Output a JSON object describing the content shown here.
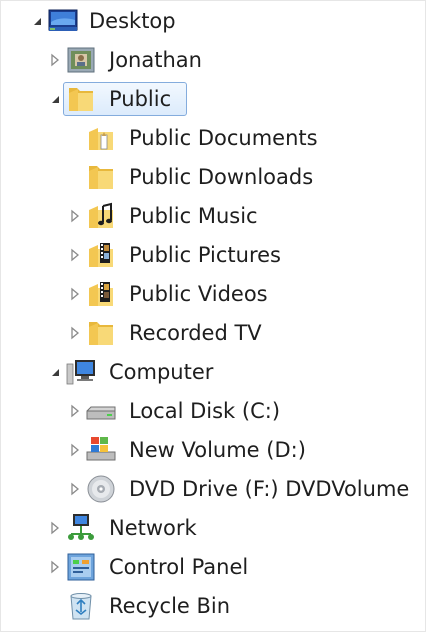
{
  "tree": {
    "items": [
      {
        "label": "Desktop",
        "icon": "desktop-icon",
        "state": "expanded"
      },
      {
        "label": "Jonathan",
        "icon": "user-folder-icon",
        "state": "collapsed"
      },
      {
        "label": "Public",
        "icon": "folder-icon",
        "state": "expanded",
        "selected": true
      },
      {
        "label": "Public Documents",
        "icon": "documents-folder-icon",
        "state": "none"
      },
      {
        "label": "Public Downloads",
        "icon": "folder-icon",
        "state": "none"
      },
      {
        "label": "Public Music",
        "icon": "music-folder-icon",
        "state": "collapsed"
      },
      {
        "label": "Public Pictures",
        "icon": "pictures-folder-icon",
        "state": "collapsed"
      },
      {
        "label": "Public Videos",
        "icon": "videos-folder-icon",
        "state": "collapsed"
      },
      {
        "label": "Recorded TV",
        "icon": "folder-icon",
        "state": "collapsed"
      },
      {
        "label": "Computer",
        "icon": "computer-icon",
        "state": "expanded"
      },
      {
        "label": "Local Disk (C:)",
        "icon": "hard-drive-icon",
        "state": "collapsed"
      },
      {
        "label": "New Volume (D:)",
        "icon": "windows-drive-icon",
        "state": "collapsed"
      },
      {
        "label": "DVD Drive (F:) DVDVolume",
        "icon": "dvd-drive-icon",
        "state": "collapsed"
      },
      {
        "label": "Network",
        "icon": "network-icon",
        "state": "collapsed"
      },
      {
        "label": "Control Panel",
        "icon": "control-panel-icon",
        "state": "collapsed"
      },
      {
        "label": "Recycle Bin",
        "icon": "recycle-bin-icon",
        "state": "none"
      }
    ]
  },
  "colors": {
    "selection_border": "#84acdd",
    "selection_fill": "#dcebfc",
    "folder_yellow": "#f6d36b",
    "expander_gray": "#8a8a8a",
    "text": "#1e1e1e"
  }
}
